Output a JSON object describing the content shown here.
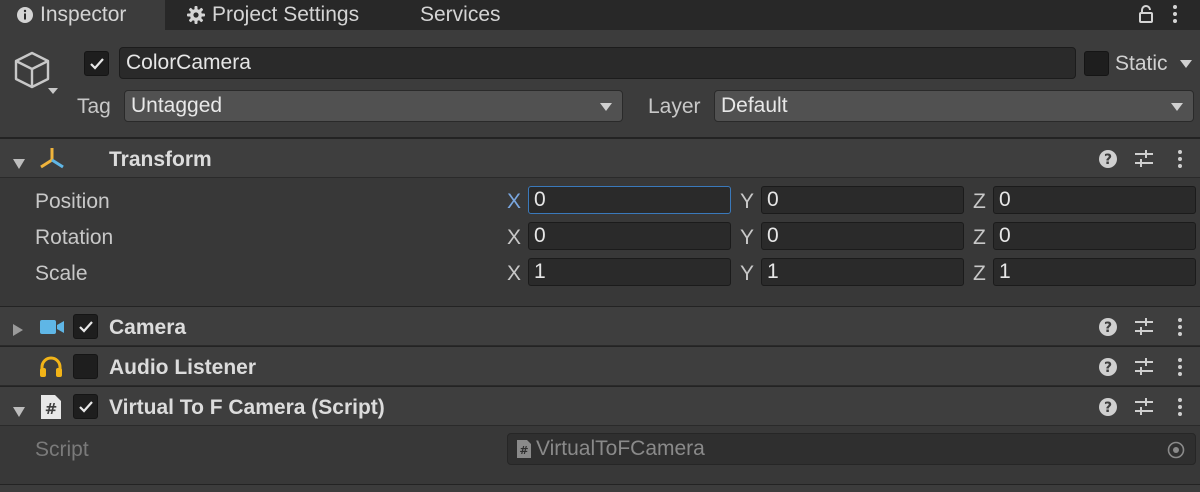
{
  "tabs": [
    {
      "label": "Inspector",
      "icon": "info-icon",
      "active": true
    },
    {
      "label": "Project Settings",
      "icon": "gear-icon",
      "active": false
    },
    {
      "label": "Services",
      "icon": "",
      "active": false
    }
  ],
  "gameobject": {
    "name": "ColorCamera",
    "active": true,
    "static_label": "Static",
    "static": false,
    "tag_label": "Tag",
    "tag_value": "Untagged",
    "layer_label": "Layer",
    "layer_value": "Default"
  },
  "components": {
    "transform": {
      "title": "Transform",
      "rows": [
        {
          "label": "Position",
          "x": "0",
          "y": "0",
          "z": "0"
        },
        {
          "label": "Rotation",
          "x": "0",
          "y": "0",
          "z": "0"
        },
        {
          "label": "Scale",
          "x": "1",
          "y": "1",
          "z": "1"
        }
      ],
      "axis": {
        "x": "X",
        "y": "Y",
        "z": "Z"
      }
    },
    "camera": {
      "title": "Camera",
      "enabled": true
    },
    "audio_listener": {
      "title": "Audio Listener",
      "enabled": false
    },
    "script": {
      "title": "Virtual To F Camera (Script)",
      "enabled": true,
      "prop_label": "Script",
      "value": "VirtualToFCamera"
    }
  },
  "colors": {
    "accent_blue": "#3a79bb",
    "camera_icon": "#5fb6e6",
    "audio_icon": "#f2b418",
    "transform_icon": "#f0b43c"
  }
}
